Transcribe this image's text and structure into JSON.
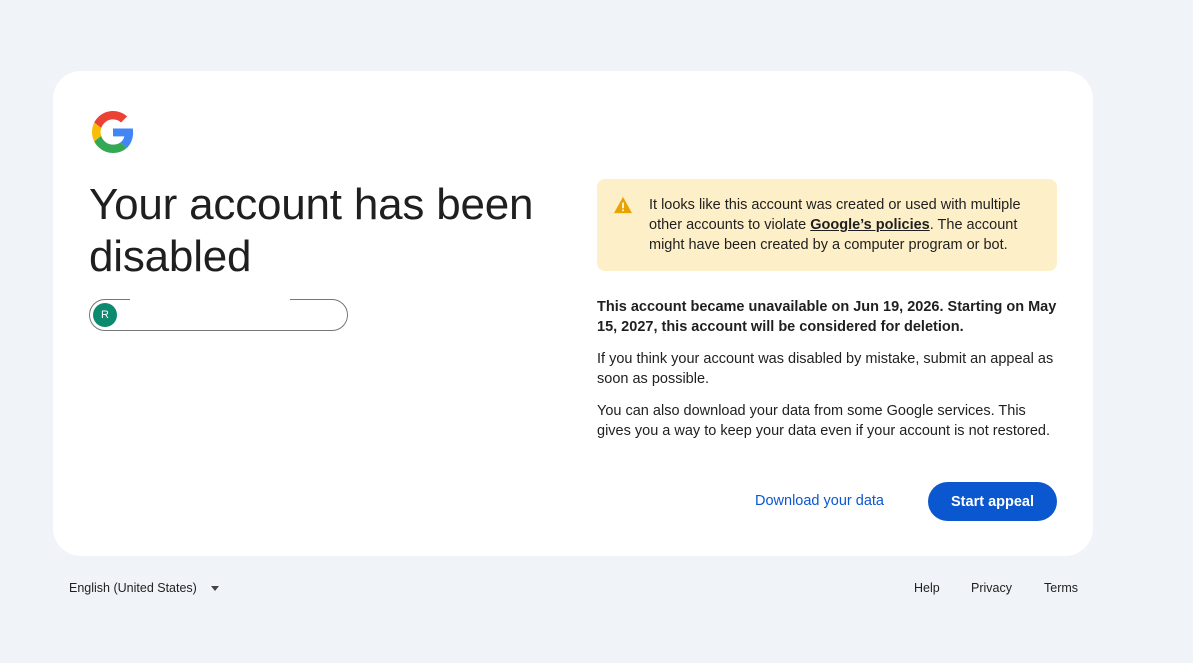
{
  "page": {
    "title_line": "Your account has been disabled"
  },
  "account": {
    "avatar_initial": "R"
  },
  "warning": {
    "text_before": "It looks like this account was created or used with multiple other accounts to violate ",
    "link_text": "Google’s policies",
    "text_after": ". The account might have been created by a computer program or bot."
  },
  "body": {
    "status_text": "This account became unavailable on Jun 19, 2026. Starting on May 15, 2027, this account will be considered for deletion.",
    "appeal_text": "If you think your account was disabled by mistake, submit an appeal as soon as possible.",
    "download_text": "You can also download your data from some Google services. This gives you a way to keep your data even if your account is not restored."
  },
  "actions": {
    "download_label": "Download your data",
    "appeal_label": "Start appeal"
  },
  "footer": {
    "language": "English (United States)",
    "help": "Help",
    "privacy": "Privacy",
    "terms": "Terms"
  },
  "colors": {
    "primary": "#0b57d0",
    "warning_bg": "#fdefc8",
    "warning_icon": "#e8a300",
    "avatar_bg": "#0b8a6f",
    "page_bg": "#f0f4f9"
  },
  "icons": {
    "logo": "google-g-logo",
    "warning": "warning-triangle-icon",
    "language_dropdown": "caret-down-icon"
  }
}
